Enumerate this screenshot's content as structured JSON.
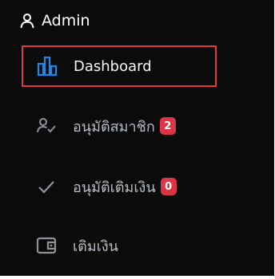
{
  "header": {
    "icon": "user-icon",
    "title": "Admin"
  },
  "menu": {
    "items": [
      {
        "icon": "bar-chart-icon",
        "label": "Dashboard",
        "active": true
      },
      {
        "icon": "user-check-icon",
        "label": "อนุมัติสมาชิก",
        "badge": "2"
      },
      {
        "icon": "check-icon",
        "label": "อนุมัติเติมเงิน",
        "badge": "0"
      },
      {
        "icon": "wallet-icon",
        "label": "เติมเงิน"
      }
    ]
  },
  "colors": {
    "background": "#0b0b0c",
    "accent": "#1e88e5",
    "highlight_border": "#e53935",
    "badge": "#dc3545",
    "muted_text": "#b7bcc3"
  }
}
